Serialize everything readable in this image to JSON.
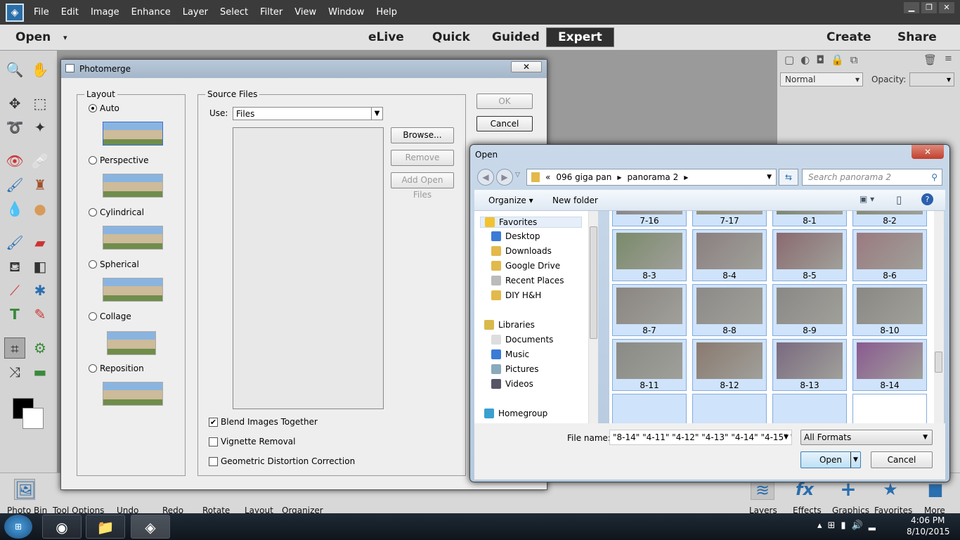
{
  "menubar": {
    "items": [
      "File",
      "Edit",
      "Image",
      "Enhance",
      "Layer",
      "Select",
      "Filter",
      "View",
      "Window",
      "Help"
    ]
  },
  "modebar": {
    "open": "Open",
    "elive": "eLive",
    "quick": "Quick",
    "guided": "Guided",
    "expert": "Expert",
    "create": "Create",
    "share": "Share"
  },
  "rightpanel": {
    "blend_mode": "Normal",
    "opacity_label": "Opacity:"
  },
  "bottombar": {
    "left": [
      "Photo Bin",
      "Tool Options",
      "Undo",
      "Redo",
      "Rotate",
      "Layout",
      "Organizer"
    ],
    "right": [
      "Layers",
      "Effects",
      "Graphics",
      "Favorites",
      "More"
    ]
  },
  "photomerge": {
    "title": "Photomerge",
    "layout_label": "Layout",
    "options": [
      "Auto",
      "Perspective",
      "Cylindrical",
      "Spherical",
      "Collage",
      "Reposition"
    ],
    "selected": "Auto",
    "source_label": "Source Files",
    "use_label": "Use:",
    "use_value": "Files",
    "browse": "Browse...",
    "remove": "Remove",
    "add_open": "Add Open Files",
    "ok": "OK",
    "cancel": "Cancel",
    "checks": [
      {
        "label": "Blend Images Together",
        "checked": true
      },
      {
        "label": "Vignette Removal",
        "checked": false
      },
      {
        "label": "Geometric Distortion Correction",
        "checked": false
      }
    ]
  },
  "open_dialog": {
    "title": "Open",
    "breadcrumb": [
      "«",
      "096 giga pan",
      "panorama 2"
    ],
    "search_placeholder": "Search panorama 2",
    "organize": "Organize",
    "new_folder": "New folder",
    "nav": [
      {
        "label": "Favorites",
        "group": true
      },
      {
        "label": "Desktop"
      },
      {
        "label": "Downloads"
      },
      {
        "label": "Google Drive"
      },
      {
        "label": "Recent Places"
      },
      {
        "label": "DIY H&H"
      },
      {
        "label": "Libraries",
        "group": true
      },
      {
        "label": "Documents"
      },
      {
        "label": "Music"
      },
      {
        "label": "Pictures"
      },
      {
        "label": "Videos"
      },
      {
        "label": "Homegroup",
        "group": true
      }
    ],
    "files": [
      "7-16",
      "7-17",
      "8-1",
      "8-2",
      "8-3",
      "8-4",
      "8-5",
      "8-6",
      "8-7",
      "8-8",
      "8-9",
      "8-10",
      "8-11",
      "8-12",
      "8-13",
      "8-14"
    ],
    "file_name_label": "File name:",
    "file_name_value": "\"8-14\" \"4-11\" \"4-12\" \"4-13\" \"4-14\" \"4-15\" \"4-1",
    "format": "All Formats",
    "open": "Open",
    "cancel": "Cancel"
  },
  "taskbar": {
    "time": "4:06 PM",
    "date": "8/10/2015"
  }
}
